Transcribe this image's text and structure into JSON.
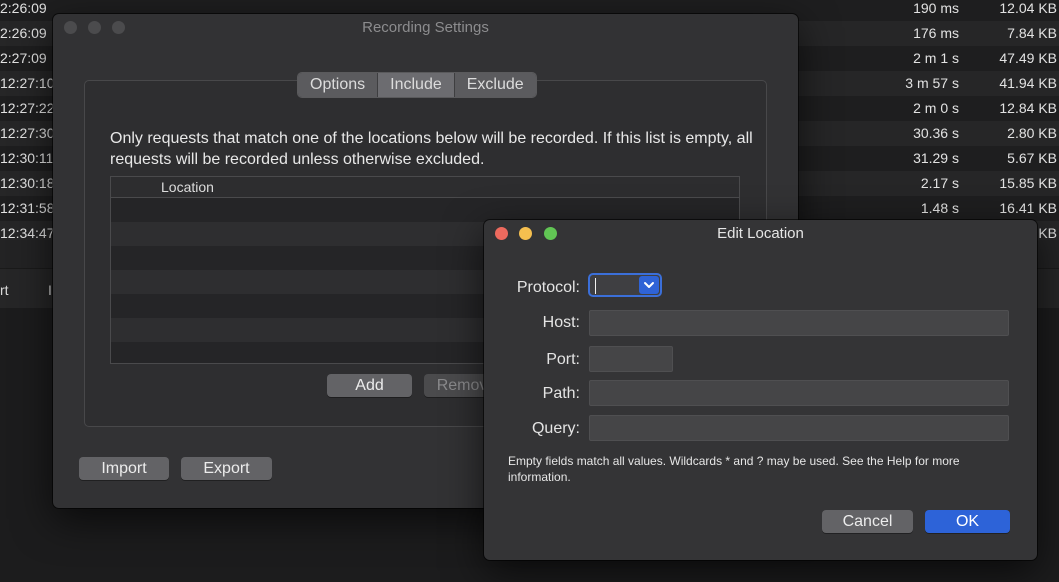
{
  "background": {
    "rows": [
      {
        "time": "2:26:09",
        "duration": "190 ms",
        "size": "12.04 KB"
      },
      {
        "time": "2:26:09",
        "duration": "176 ms",
        "size": "7.84 KB"
      },
      {
        "time": "2:27:09",
        "duration": "2 m 1 s",
        "size": "47.49 KB"
      },
      {
        "time": "12:27:10",
        "duration": "3 m 57 s",
        "size": "41.94 KB"
      },
      {
        "time": "12:27:22",
        "duration": "2 m 0 s",
        "size": "12.84 KB"
      },
      {
        "time": "12:27:30",
        "duration": "30.36 s",
        "size": "2.80 KB"
      },
      {
        "time": "12:30:11",
        "duration": "31.29 s",
        "size": "5.67 KB"
      },
      {
        "time": "12:30:18",
        "duration": "2.17 s",
        "size": "15.85 KB"
      },
      {
        "time": "12:31:58",
        "duration": "1.48 s",
        "size": "16.41 KB"
      },
      {
        "time": "12:34:47",
        "duration": "",
        "size": "KB"
      }
    ],
    "tab_a": "rt",
    "tab_b": "I"
  },
  "recording_settings": {
    "title": "Recording Settings",
    "tabs": [
      {
        "label": "Options",
        "active": false
      },
      {
        "label": "Include",
        "active": true
      },
      {
        "label": "Exclude",
        "active": false
      }
    ],
    "description": "Only requests that match one of the locations below will be recorded. If this list is empty, all requests will be recorded unless otherwise excluded.",
    "table_header": "Location",
    "add_label": "Add",
    "remove_label": "Remove",
    "import_label": "Import",
    "export_label": "Export"
  },
  "edit_location": {
    "title": "Edit Location",
    "protocol_label": "Protocol:",
    "protocol_value": "",
    "host_label": "Host:",
    "host_value": "",
    "port_label": "Port:",
    "port_value": "",
    "path_label": "Path:",
    "path_value": "",
    "query_label": "Query:",
    "query_value": "",
    "hint": "Empty fields match all values. Wildcards * and ? may be used. See the Help for more information.",
    "cancel_label": "Cancel",
    "ok_label": "OK"
  },
  "colors": {
    "close": "#ed6a5e",
    "minimize": "#f5bf4f",
    "zoom": "#61c554",
    "accent": "#2d63d8"
  },
  "icons": {
    "select_arrow": "chevron-down-icon"
  }
}
